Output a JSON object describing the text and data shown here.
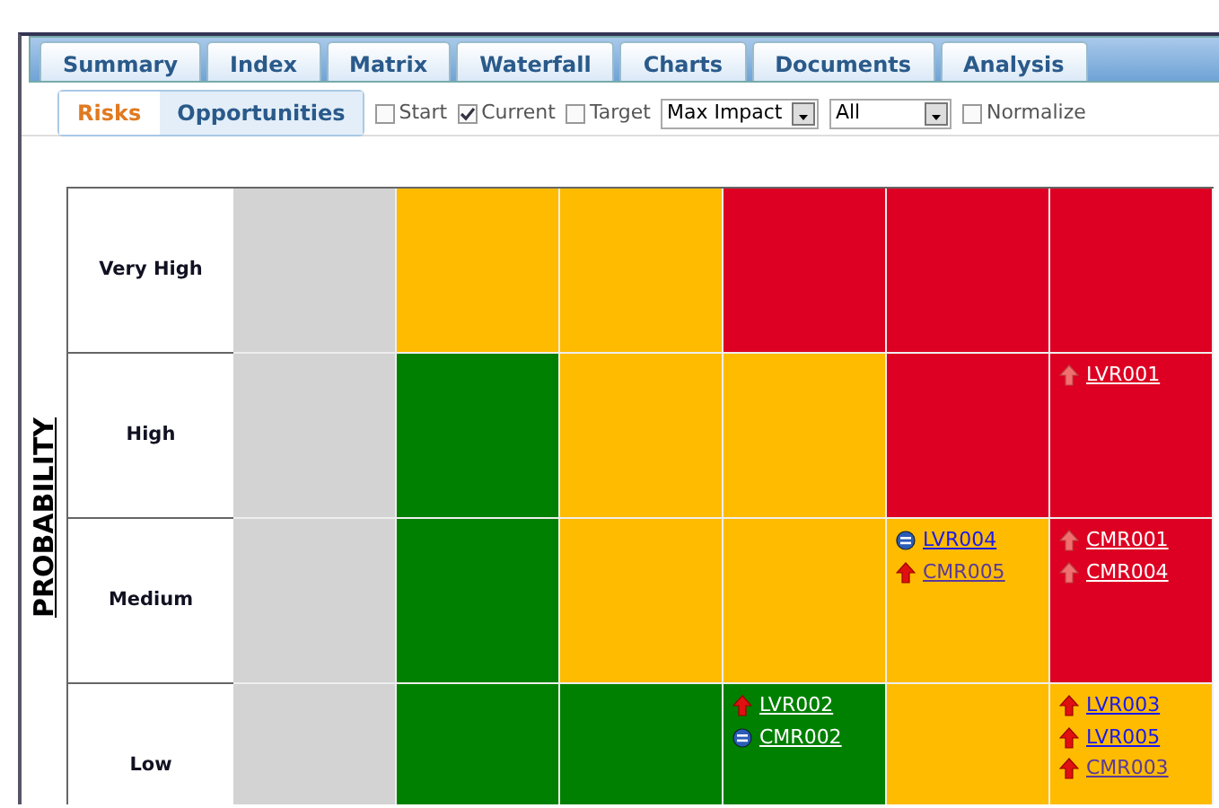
{
  "tabs": [
    {
      "label": "Summary"
    },
    {
      "label": "Index"
    },
    {
      "label": "Matrix"
    },
    {
      "label": "Waterfall"
    },
    {
      "label": "Charts"
    },
    {
      "label": "Documents"
    },
    {
      "label": "Analysis"
    }
  ],
  "toggle": [
    {
      "label": "Risks",
      "selected": true
    },
    {
      "label": "Opportunities",
      "selected": false
    }
  ],
  "filters": [
    {
      "kind": "checkbox",
      "label": "Start",
      "checked": false
    },
    {
      "kind": "checkbox",
      "label": "Current",
      "checked": true
    },
    {
      "kind": "checkbox",
      "label": "Target",
      "checked": false
    },
    {
      "kind": "select",
      "value": "Max Impact"
    },
    {
      "kind": "select",
      "value": "All"
    },
    {
      "kind": "checkbox",
      "label": "Normalize",
      "checked": false
    }
  ],
  "matrix": {
    "y_axis_label": "PROBABILITY",
    "rows": [
      {
        "label": "Very High",
        "cells": [
          {
            "color": "#d3d3d3"
          },
          {
            "color": "#ffbb00"
          },
          {
            "color": "#ffbb00"
          },
          {
            "color": "#dd0022"
          },
          {
            "color": "#dd0022"
          },
          {
            "color": "#dd0022"
          }
        ]
      },
      {
        "label": "High",
        "cells": [
          {
            "color": "#d3d3d3"
          },
          {
            "color": "#008000"
          },
          {
            "color": "#ffbb00"
          },
          {
            "color": "#ffbb00"
          },
          {
            "color": "#dd0022"
          },
          {
            "color": "#dd0022",
            "items": [
              {
                "id": "LVR001",
                "kind": "up-faded"
              }
            ]
          }
        ]
      },
      {
        "label": "Medium",
        "cells": [
          {
            "color": "#d3d3d3"
          },
          {
            "color": "#008000"
          },
          {
            "color": "#ffbb00"
          },
          {
            "color": "#ffbb00"
          },
          {
            "color": "#ffbb00",
            "items": [
              {
                "id": "LVR004",
                "kind": "equal",
                "visited": false
              },
              {
                "id": "CMR005",
                "kind": "up",
                "visited": true
              }
            ]
          },
          {
            "color": "#dd0022",
            "items": [
              {
                "id": "CMR001",
                "kind": "up-faded"
              },
              {
                "id": "CMR004",
                "kind": "up-faded"
              }
            ]
          }
        ]
      },
      {
        "label": "Low",
        "cells": [
          {
            "color": "#d3d3d3"
          },
          {
            "color": "#008000"
          },
          {
            "color": "#008000"
          },
          {
            "color": "#008000",
            "items": [
              {
                "id": "LVR002",
                "kind": "up"
              },
              {
                "id": "CMR002",
                "kind": "equal"
              }
            ]
          },
          {
            "color": "#ffbb00"
          },
          {
            "color": "#ffbb00",
            "items": [
              {
                "id": "LVR003",
                "kind": "up",
                "visited": false
              },
              {
                "id": "LVR005",
                "kind": "up",
                "visited": false
              },
              {
                "id": "CMR003",
                "kind": "up",
                "visited": true
              }
            ]
          }
        ]
      }
    ]
  }
}
